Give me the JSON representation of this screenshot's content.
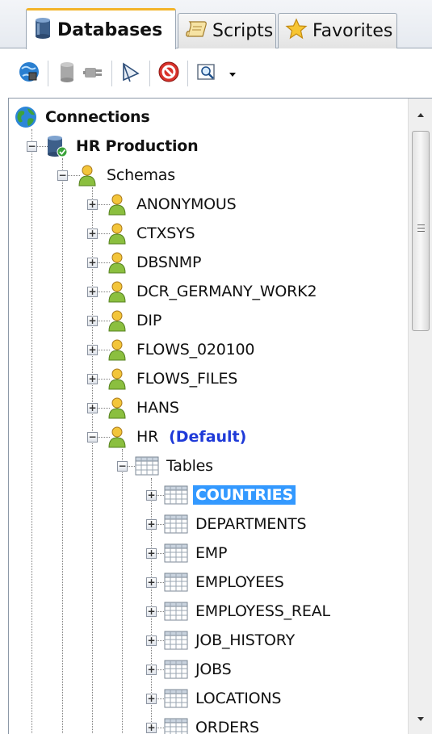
{
  "tabs": [
    {
      "label": "Databases",
      "icon": "database-icon",
      "active": true
    },
    {
      "label": "Scripts",
      "icon": "scroll-icon",
      "active": false
    },
    {
      "label": "Favorites",
      "icon": "star-icon",
      "active": false
    }
  ],
  "toolbar": {
    "buttons": [
      {
        "icon": "connect-icon",
        "enabled": true
      },
      {
        "icon": "database-disabled-icon",
        "enabled": false
      },
      {
        "icon": "plug-disabled-icon",
        "enabled": false
      },
      {
        "icon": "funnel-icon",
        "enabled": true
      },
      {
        "icon": "stop-icon",
        "enabled": true
      },
      {
        "icon": "search-icon",
        "enabled": true
      },
      {
        "icon": "dropdown-arrow-icon",
        "enabled": true
      }
    ]
  },
  "tree": {
    "connections": "Connections",
    "connection": "HR Production",
    "schemas_folder": "Schemas",
    "schemas": [
      "ANONYMOUS",
      "CTXSYS",
      "DBSNMP",
      "DCR_GERMANY_WORK2",
      "DIP",
      "FLOWS_020100",
      "FLOWS_FILES",
      "HANS"
    ],
    "hr_schema": "HR",
    "default_tag": "(Default)",
    "tables_folder": "Tables",
    "tables": [
      "COUNTRIES",
      "DEPARTMENTS",
      "EMP",
      "EMPLOYEES",
      "EMPLOYESS_REAL",
      "JOB_HISTORY",
      "JOBS",
      "LOCATIONS",
      "ORDERS"
    ],
    "selected_table": "COUNTRIES"
  },
  "colors": {
    "selection": "#3399ff",
    "default_tag": "#1f3ad8",
    "active_tab_accent": "#f3b42a"
  }
}
